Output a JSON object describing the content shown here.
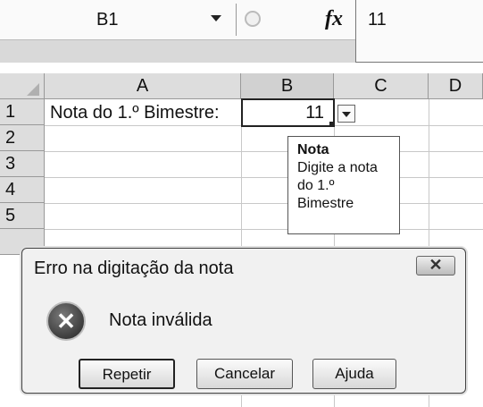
{
  "formula_bar": {
    "name_box": "B1",
    "fx_label": "fx",
    "formula_value": "11"
  },
  "sheet": {
    "columns": [
      "A",
      "B",
      "C",
      "D"
    ],
    "rows": [
      "1",
      "2",
      "3",
      "4",
      "5"
    ],
    "cells": {
      "A1": "Nota do 1.º Bimestre:",
      "B1": "11"
    },
    "selected_cell": "B1"
  },
  "tooltip": {
    "title": "Nota",
    "body": "Digite a nota do 1.º Bimestre"
  },
  "dialog": {
    "title": "Erro na digitação da nota",
    "message": "Nota inválida",
    "buttons": {
      "retry": "Repetir",
      "cancel": "Cancelar",
      "help": "Ajuda"
    }
  }
}
